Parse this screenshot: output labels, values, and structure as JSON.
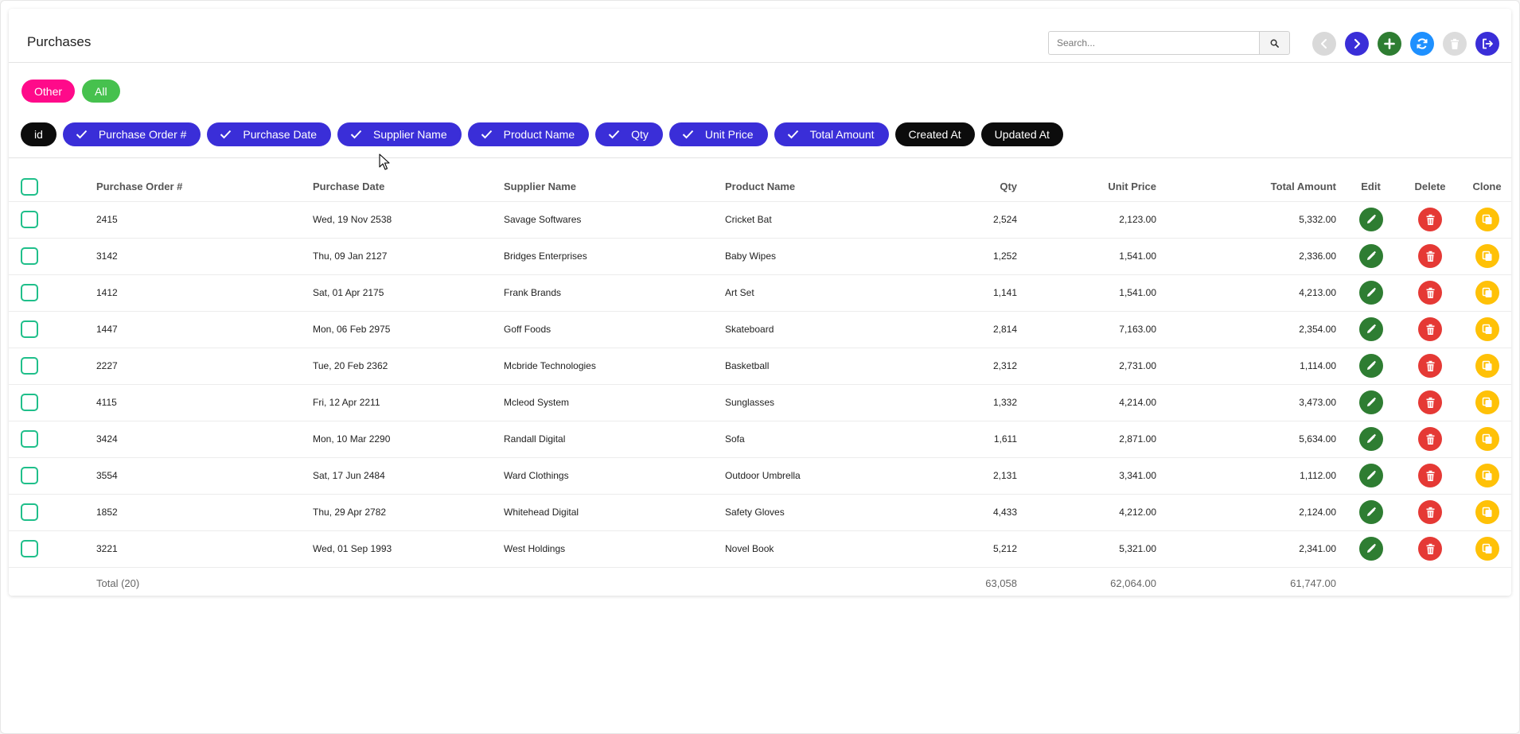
{
  "page_title": "Purchases",
  "search": {
    "placeholder": "Search..."
  },
  "toolbar": {
    "icons": [
      "chevron-left-icon",
      "chevron-right-icon",
      "plus-icon",
      "refresh-icon",
      "trash-icon",
      "logout-icon"
    ],
    "colors": {
      "prev": "#d9d9d9",
      "next": "#3a2ed8",
      "add": "#2e7d32",
      "refresh": "#1e90ff",
      "delete_disabled": "#dcdcdc",
      "logout": "#3a2ed8"
    }
  },
  "filters": [
    {
      "label": "Other",
      "color": "#ff0a8a"
    },
    {
      "label": "All",
      "color": "#46c14e"
    }
  ],
  "columns_toggle": [
    {
      "label": "id",
      "checked": false
    },
    {
      "label": "Purchase Order #",
      "checked": true
    },
    {
      "label": "Purchase Date",
      "checked": true
    },
    {
      "label": "Supplier Name",
      "checked": true
    },
    {
      "label": "Product Name",
      "checked": true
    },
    {
      "label": "Qty",
      "checked": true
    },
    {
      "label": "Unit Price",
      "checked": true
    },
    {
      "label": "Total Amount",
      "checked": true
    },
    {
      "label": "Created At",
      "checked": false
    },
    {
      "label": "Updated At",
      "checked": false
    }
  ],
  "table": {
    "headers": {
      "po": "Purchase Order #",
      "date": "Purchase Date",
      "supplier": "Supplier Name",
      "product": "Product Name",
      "qty": "Qty",
      "unit_price": "Unit Price",
      "total_amount": "Total Amount",
      "edit": "Edit",
      "delete": "Delete",
      "clone": "Clone"
    },
    "rows": [
      {
        "po": "2415",
        "date": "Wed, 19 Nov 2538",
        "supplier": "Savage Softwares",
        "product": "Cricket Bat",
        "qty": "2,524",
        "unit_price": "2,123.00",
        "total_amount": "5,332.00"
      },
      {
        "po": "3142",
        "date": "Thu, 09 Jan 2127",
        "supplier": "Bridges Enterprises",
        "product": "Baby Wipes",
        "qty": "1,252",
        "unit_price": "1,541.00",
        "total_amount": "2,336.00"
      },
      {
        "po": "1412",
        "date": "Sat, 01 Apr 2175",
        "supplier": "Frank Brands",
        "product": "Art Set",
        "qty": "1,141",
        "unit_price": "1,541.00",
        "total_amount": "4,213.00"
      },
      {
        "po": "1447",
        "date": "Mon, 06 Feb 2975",
        "supplier": "Goff Foods",
        "product": "Skateboard",
        "qty": "2,814",
        "unit_price": "7,163.00",
        "total_amount": "2,354.00"
      },
      {
        "po": "2227",
        "date": "Tue, 20 Feb 2362",
        "supplier": "Mcbride Technologies",
        "product": "Basketball",
        "qty": "2,312",
        "unit_price": "2,731.00",
        "total_amount": "1,114.00"
      },
      {
        "po": "4115",
        "date": "Fri, 12 Apr 2211",
        "supplier": "Mcleod System",
        "product": "Sunglasses",
        "qty": "1,332",
        "unit_price": "4,214.00",
        "total_amount": "3,473.00"
      },
      {
        "po": "3424",
        "date": "Mon, 10 Mar 2290",
        "supplier": "Randall Digital",
        "product": "Sofa",
        "qty": "1,611",
        "unit_price": "2,871.00",
        "total_amount": "5,634.00"
      },
      {
        "po": "3554",
        "date": "Sat, 17 Jun 2484",
        "supplier": "Ward Clothings",
        "product": "Outdoor Umbrella",
        "qty": "2,131",
        "unit_price": "3,341.00",
        "total_amount": "1,112.00"
      },
      {
        "po": "1852",
        "date": "Thu, 29 Apr 2782",
        "supplier": "Whitehead Digital",
        "product": "Safety Gloves",
        "qty": "4,433",
        "unit_price": "4,212.00",
        "total_amount": "2,124.00"
      },
      {
        "po": "3221",
        "date": "Wed, 01 Sep 1993",
        "supplier": "West Holdings",
        "product": "Novel Book",
        "qty": "5,212",
        "unit_price": "5,321.00",
        "total_amount": "2,341.00"
      }
    ],
    "totals": {
      "label": "Total (20)",
      "qty": "63,058",
      "unit_price": "62,064.00",
      "total_amount": "61,747.00"
    },
    "action_colors": {
      "edit": "#2e7d32",
      "delete": "#e53935",
      "clone": "#ffc107"
    }
  }
}
